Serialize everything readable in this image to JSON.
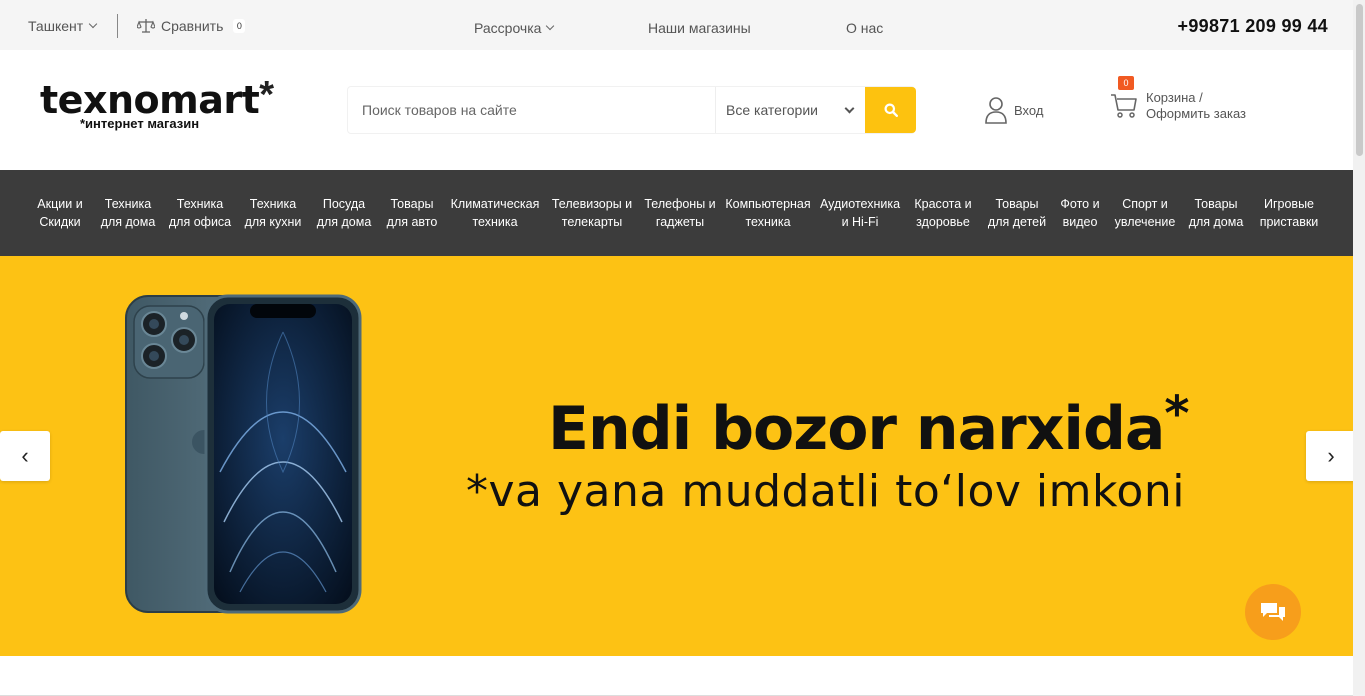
{
  "topbar": {
    "city": "Ташкент",
    "compare_label": "Сравнить",
    "compare_count": "0",
    "links": [
      "Рассрочка",
      "Наши магазины",
      "О нас"
    ],
    "phone": "+99871 209 99 44"
  },
  "header": {
    "logo_name": "texnomart",
    "logo_star": "*",
    "logo_tag": "*интернет магазин",
    "search_placeholder": "Поиск товаров на сайте",
    "category_select": "Все категории",
    "login_label": "Вход",
    "cart_count": "0",
    "cart_line1": "Корзина /",
    "cart_line2": "Оформить заказ"
  },
  "categories": [
    [
      "Акции и",
      "Скидки"
    ],
    [
      "Техника",
      "для дома"
    ],
    [
      "Техника",
      "для офиса"
    ],
    [
      "Техника",
      "для кухни"
    ],
    [
      "Посуда",
      "для дома"
    ],
    [
      "Товары",
      "для авто"
    ],
    [
      "Климатическая",
      "техника"
    ],
    [
      "Телевизоры и",
      "телекарты"
    ],
    [
      "Телефоны и",
      "гаджеты"
    ],
    [
      "Компьютерная",
      "техника"
    ],
    [
      "Аудиотехника",
      "и Hi-Fi"
    ],
    [
      "Красота и",
      "здоровье"
    ],
    [
      "Товары",
      "для детей"
    ],
    [
      "Фото и",
      "видео"
    ],
    [
      "Спорт и",
      "увлечение"
    ],
    [
      "Товары",
      "для дома"
    ],
    [
      "Игровые",
      "приставки"
    ]
  ],
  "hero": {
    "title": "Endi bozor narxida",
    "title_mark": "*",
    "subtitle": "*va yana muddatli to‘lov imkoni",
    "prev": "‹",
    "next": "›"
  },
  "colors": {
    "accent": "#fdc214",
    "nav_bg": "#3c3c3c",
    "badge": "#f15a22",
    "chat": "#f79e1b"
  }
}
